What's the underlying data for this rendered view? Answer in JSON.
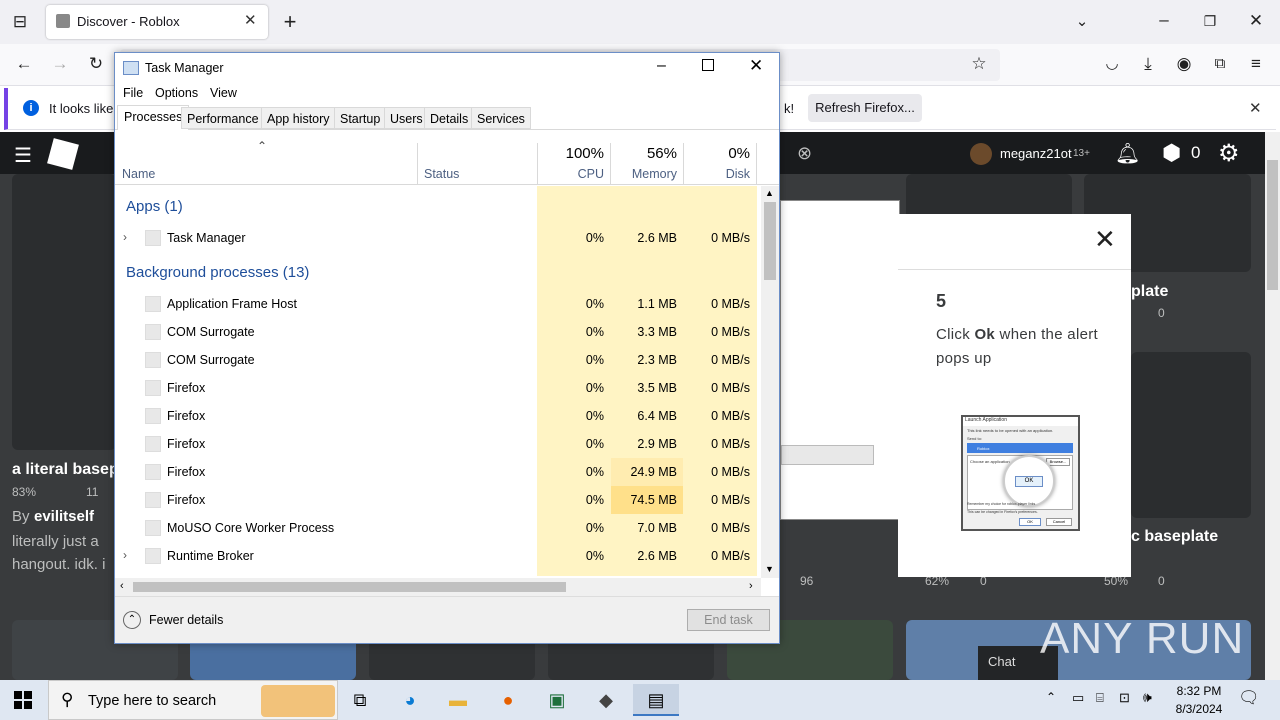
{
  "browser": {
    "tab_title": "Discover - Roblox",
    "notification_text": "It looks like y",
    "notification_tail": "k!",
    "refresh_button": "Refresh Firefox..."
  },
  "roblox": {
    "username": "meganz21ot",
    "age_tag": "13+",
    "robux": "0",
    "cards": [
      {
        "title": "a literal basep",
        "likes": "83%",
        "players": "11",
        "by_prefix": "By",
        "author": "evilitself",
        "desc1": "literally just a",
        "desc2": "hangout. idk. i"
      },
      {
        "title": "plate",
        "players": "0"
      },
      {
        "title": "c baseplate"
      }
    ],
    "lower_stats": [
      {
        "players": "96"
      },
      {
        "likes": "62%",
        "players": "0"
      },
      {
        "likes": "50%",
        "players": "0"
      }
    ],
    "chat_label": "Chat"
  },
  "dialog": {
    "step_number": "5",
    "instruction_pre": "Click ",
    "instruction_bold": "Ok",
    "instruction_post": " when the alert pops up",
    "thumb_title": "Launch Application",
    "thumb_line1": "This link needs to be opened with an application.",
    "thumb_send_to": "Send to:",
    "thumb_selected": "Roblox",
    "thumb_choose": "Choose an application",
    "thumb_browse": "Browse...",
    "thumb_ok": "OK",
    "thumb_remember": "Remember my choice for roblox-player links",
    "thumb_footer": "This can be changed in Firefox's preferences.",
    "thumb_ok_small": "OK",
    "thumb_cancel": "Cancel"
  },
  "task_manager": {
    "title": "Task Manager",
    "menu": [
      "File",
      "Options",
      "View"
    ],
    "tabs": [
      "Processes",
      "Performance",
      "App history",
      "Startup",
      "Users",
      "Details",
      "Services"
    ],
    "columns": {
      "name": "Name",
      "status": "Status",
      "cpu_pct": "100%",
      "cpu": "CPU",
      "mem_pct": "56%",
      "mem": "Memory",
      "disk_pct": "0%",
      "disk": "Disk"
    },
    "groups": {
      "apps": "Apps (1)",
      "background": "Background processes (13)"
    },
    "apps": [
      {
        "name": "Task Manager",
        "cpu": "0%",
        "mem": "2.6 MB",
        "disk": "0 MB/s",
        "expandable": true
      }
    ],
    "background": [
      {
        "name": "Application Frame Host",
        "cpu": "0%",
        "mem": "1.1 MB",
        "disk": "0 MB/s"
      },
      {
        "name": "COM Surrogate",
        "cpu": "0%",
        "mem": "3.3 MB",
        "disk": "0 MB/s"
      },
      {
        "name": "COM Surrogate",
        "cpu": "0%",
        "mem": "2.3 MB",
        "disk": "0 MB/s"
      },
      {
        "name": "Firefox",
        "cpu": "0%",
        "mem": "3.5 MB",
        "disk": "0 MB/s"
      },
      {
        "name": "Firefox",
        "cpu": "0%",
        "mem": "6.4 MB",
        "disk": "0 MB/s"
      },
      {
        "name": "Firefox",
        "cpu": "0%",
        "mem": "2.9 MB",
        "disk": "0 MB/s"
      },
      {
        "name": "Firefox",
        "cpu": "0%",
        "mem": "24.9 MB",
        "disk": "0 MB/s"
      },
      {
        "name": "Firefox",
        "cpu": "0%",
        "mem": "74.5 MB",
        "disk": "0 MB/s"
      },
      {
        "name": "MoUSO Core Worker Process",
        "cpu": "0%",
        "mem": "7.0 MB",
        "disk": "0 MB/s"
      },
      {
        "name": "Runtime Broker",
        "cpu": "0%",
        "mem": "2.6 MB",
        "disk": "0 MB/s",
        "expandable": true
      }
    ],
    "fewer_details": "Fewer details",
    "end_task": "End task"
  },
  "taskbar": {
    "search_placeholder": "Type here to search",
    "time": "8:32 PM",
    "date": "8/3/2024"
  },
  "watermark": {
    "text": "ANY RUN"
  }
}
